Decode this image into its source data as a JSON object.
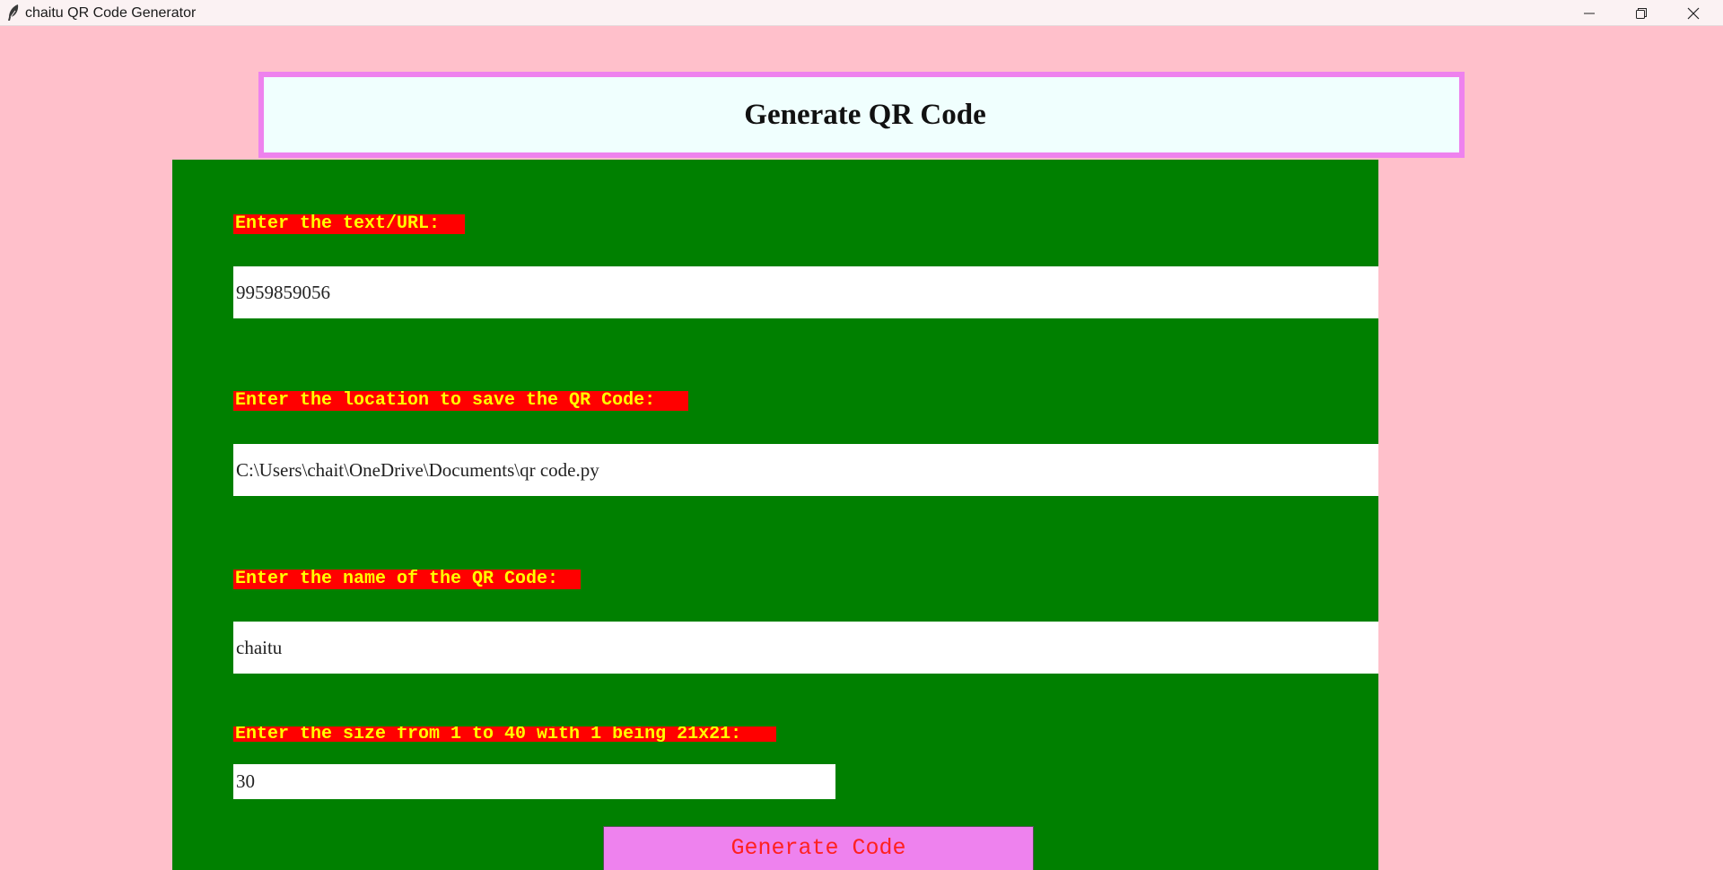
{
  "window": {
    "title": "chaitu QR Code Generator",
    "controls": {
      "minimize_icon": "minimize-icon",
      "maximize_icon": "restore-icon",
      "close_icon": "close-icon"
    }
  },
  "header": {
    "title": "Generate QR Code"
  },
  "form": {
    "text_label": "Enter the text/URL: ",
    "text_value": "9959859056",
    "location_label": "Enter the location to save the QR Code: ",
    "location_value": "C:\\Users\\chait\\OneDrive\\Documents\\qr code.py",
    "name_label": "Enter the name of the QR Code: ",
    "name_value": "chaitu",
    "size_label": "Enter the size from 1 to 40 with 1 being 21x21: ",
    "size_value": "30",
    "generate_button": "Generate Code"
  },
  "colors": {
    "background": "#ffc0cb",
    "panel": "#008000",
    "header_bg": "#f0fffe",
    "header_border": "#ee82ee",
    "label_bg": "#ff0000",
    "label_text": "#ffff00",
    "button_bg": "#ee82ee",
    "button_text": "#ff2020"
  }
}
